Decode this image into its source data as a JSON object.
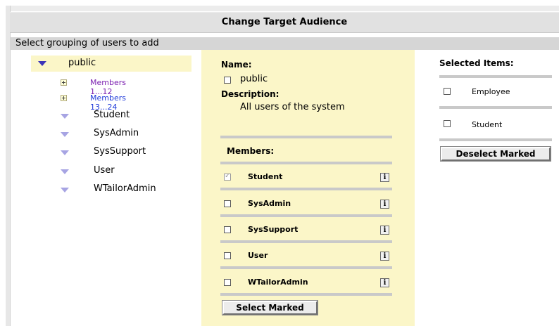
{
  "header": {
    "title": "Change Target Audience"
  },
  "subheader": {
    "text": "Select grouping of users to add"
  },
  "tree": {
    "root": "public",
    "nodes": [
      {
        "label": "Members 1...12",
        "type": "expand",
        "color": "#7b1fb0"
      },
      {
        "label": "Members 13...24",
        "type": "expand",
        "color": "#1f3ad9"
      },
      {
        "label": "Student",
        "type": "group"
      },
      {
        "label": "SysAdmin",
        "type": "group"
      },
      {
        "label": "SysSupport",
        "type": "group"
      },
      {
        "label": "User",
        "type": "group"
      },
      {
        "label": "WTailorAdmin",
        "type": "group"
      }
    ]
  },
  "details": {
    "name_heading": "Name:",
    "name_value": "public",
    "description_heading": "Description:",
    "description_value": "All users of the system",
    "members_heading": "Members:",
    "members": [
      {
        "label": "Student",
        "checked": true
      },
      {
        "label": "SysAdmin",
        "checked": false
      },
      {
        "label": "SysSupport",
        "checked": false
      },
      {
        "label": "User",
        "checked": false
      },
      {
        "label": "WTailorAdmin",
        "checked": false
      }
    ],
    "info_glyph": "i",
    "select_button": "Select Marked"
  },
  "selected": {
    "heading": "Selected Items:",
    "items": [
      "Employee",
      "Student"
    ],
    "deselect_button": "Deselect Marked"
  },
  "colors": {
    "panel_yellow": "#fbf6c8",
    "title_bar": "#e1e1e1",
    "sub_bar": "#d6d6d6"
  }
}
